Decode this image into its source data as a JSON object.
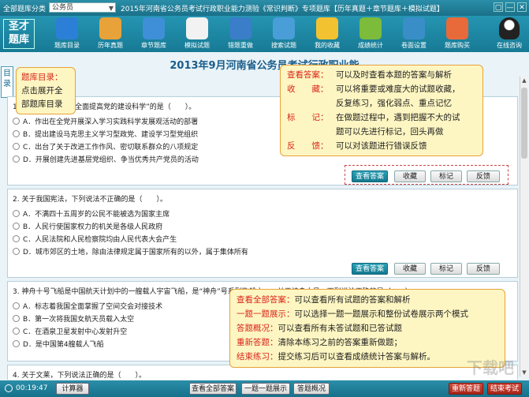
{
  "topbar": {
    "category_label": "全部题库分类",
    "category_value": "公务员",
    "title": "2015年河南省公务员考试行政职业能力测验《常识判断》专项题库【历年真题＋章节题库＋模拟试题】",
    "window_controls": [
      "▢",
      "—",
      "✕"
    ]
  },
  "logo": {
    "line1": "圣才",
    "line2": "题库"
  },
  "toolbar": {
    "items": [
      {
        "label": "题库目录",
        "icon": "catalog-icon",
        "color": "#2c7fd6"
      },
      {
        "label": "历年真题",
        "icon": "past-exam-icon",
        "color": "#e8a23a"
      },
      {
        "label": "章节题库",
        "icon": "chapter-icon",
        "color": "#3f8fd8"
      },
      {
        "label": "模拟试题",
        "icon": "mock-exam-icon",
        "color": "#f2f2f2"
      },
      {
        "label": "错题重做",
        "icon": "redo-icon",
        "color": "#3a7dc8"
      },
      {
        "label": "搜索试题",
        "icon": "search-icon",
        "color": "#4a9ed8"
      },
      {
        "label": "我的收藏",
        "icon": "bookmark-icon",
        "color": "#f2c230"
      },
      {
        "label": "成绩统计",
        "icon": "stats-icon",
        "color": "#7dbb3a"
      },
      {
        "label": "卷面设置",
        "icon": "settings-icon",
        "color": "#3a8ec8"
      },
      {
        "label": "题库购买",
        "icon": "cart-icon",
        "color": "#e86a3a"
      }
    ],
    "qq_label": "在线咨询"
  },
  "exam_title": "2013年9月河南省公务员考试行政职业能",
  "side_tab": {
    "line1": "目",
    "line2": "录"
  },
  "questions": [
    {
      "text": "1. 根据党的十八大“全面提高党的建设科学”的是（　　）。",
      "options": [
        "A．作出在全党开展深入学习实践科学发展观活动的部署",
        "B．提出建设马克思主义学习型政党、建设学习型党组织",
        "C．出台了关于改进工作作风、密切联系群众的八项规定",
        "D．开展创建先进基层党组织、争当优秀共产党员的活动"
      ]
    },
    {
      "text": "2. 关于我国宪法，下列说法不正确的是（　　）。",
      "options": [
        "A．不满四十五周岁的公民不能被选为国家主席",
        "B．人民行使国家权力的机关是各级人民政府",
        "C．人民法院和人民检察院均由人民代表大会产生",
        "D．城市郊区的土地，除由法律规定属于国家所有的以外，属于集体所有"
      ]
    },
    {
      "text": "3. 神舟十号飞船是中国航天计划中的一艘载人宇宙飞船，是“神舟”号系列飞船之一，关于神舟十号，下列说法正确的是（　　）。",
      "options": [
        "A．标志着我国全面掌握了空间交会对接技术",
        "B．第一次将我国女航天员载入太空",
        "C．在酒泉卫星发射中心发射升空",
        "D．是中国第4艘载人飞船"
      ]
    },
    {
      "text": "4. 关于文莱，下列说法正确的是（　　）。"
    }
  ],
  "question_buttons": {
    "view_answer": "查看答案",
    "favorite": "收藏",
    "mark": "标记",
    "feedback": "反馈"
  },
  "callout_catalog": {
    "line1": "题库目录：",
    "line2": "点击展开全",
    "line3": "部题库目录"
  },
  "callout_top": {
    "rows": [
      {
        "key": "查看答案：",
        "desc": "可以及时查看本题的答案与解析"
      },
      {
        "key": "收　　藏：",
        "desc": "可以将重要或难度大的试题收藏，"
      },
      {
        "key": "",
        "desc": "反复练习，强化弱点、重点记忆"
      },
      {
        "key": "标　　记：",
        "desc": "在做题过程中，遇到把握不大的试"
      },
      {
        "key": "",
        "desc": "题可以先进行标记，回头再做"
      },
      {
        "key": "反　　馈：",
        "desc": "可以对该题进行错误反馈"
      }
    ]
  },
  "callout_bottom": {
    "rows": [
      {
        "key": "查看全部答案：",
        "desc": "可以查看所有试题的答案和解析"
      },
      {
        "key": "一题一题展示：",
        "desc": "可以选择一题一题展示和整份试卷展示两个模式"
      },
      {
        "key": "答题概况：",
        "desc": "可以查看所有未答试题和已答试题"
      },
      {
        "key": "重新答题：",
        "desc": "清除本练习之前的答案重新做题；"
      },
      {
        "key": "结束练习：",
        "desc": "提交练习后可以查看成绩统计答案与解析。"
      }
    ]
  },
  "bottombar": {
    "timer": "00:19:47",
    "calculator": "计算器",
    "view_all": "查看全部答案",
    "one_by_one": "一题一题展示",
    "overview": "答题概况",
    "restart": "重新答题",
    "finish": "结束考试"
  },
  "watermark": "下载吧"
}
